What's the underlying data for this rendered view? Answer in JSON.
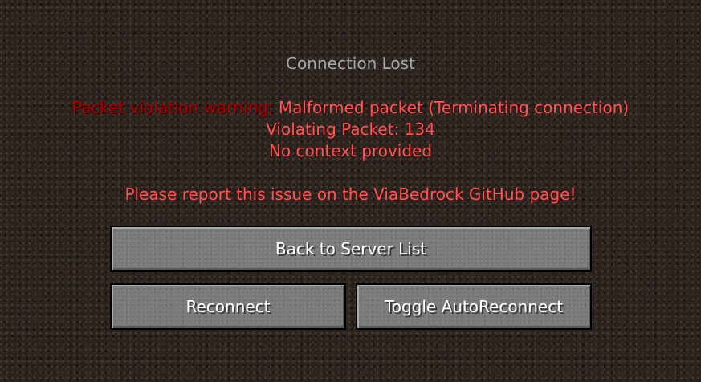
{
  "screen": {
    "title": "Connection Lost",
    "message": {
      "line1_prefix": "Packet violation warning:",
      "line1_text": " Malformed packet (Terminating connection)",
      "line2": "Violating Packet: 134",
      "line3": "No context provided",
      "line4": "Please report this issue on the ViaBedrock GitHub page!"
    },
    "colors": {
      "prefix": "#aa0000",
      "message": "#ff5555",
      "title": "#a8a8a8"
    }
  },
  "buttons": {
    "back_label": "Back to Server List",
    "reconnect_label": "Reconnect",
    "toggle_label": "Toggle AutoReconnect"
  }
}
